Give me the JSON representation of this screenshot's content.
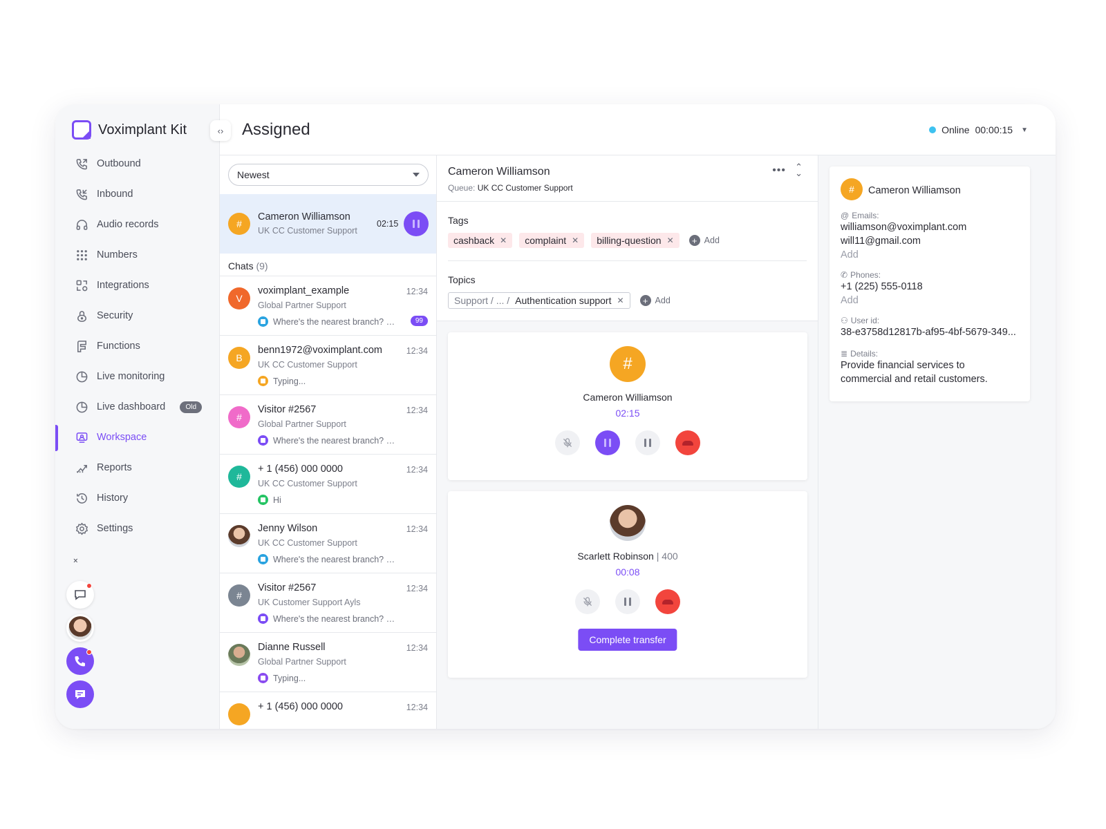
{
  "app": {
    "name": "Voximplant Kit"
  },
  "sidebar": {
    "items": [
      {
        "label": "Outbound",
        "icon": "outbound-call-icon"
      },
      {
        "label": "Inbound",
        "icon": "inbound-call-icon"
      },
      {
        "label": "Audio records",
        "icon": "headphones-icon"
      },
      {
        "label": "Numbers",
        "icon": "dialpad-icon"
      },
      {
        "label": "Integrations",
        "icon": "integrations-icon"
      },
      {
        "label": "Security",
        "icon": "lock-icon"
      },
      {
        "label": "Functions",
        "icon": "functions-icon"
      },
      {
        "label": "Live monitoring",
        "icon": "pie-chart-icon"
      },
      {
        "label": "Live dashboard",
        "icon": "pie-chart-icon",
        "badge": "Old"
      },
      {
        "label": "Workspace",
        "icon": "workspace-icon",
        "active": true
      },
      {
        "label": "Reports",
        "icon": "reports-icon"
      },
      {
        "label": "History",
        "icon": "history-icon"
      },
      {
        "label": "Settings",
        "icon": "gear-icon"
      }
    ]
  },
  "header": {
    "title": "Assigned",
    "status_label": "Online",
    "status_time": "00:00:15",
    "status_color": "#3ec2f0"
  },
  "list": {
    "filter_value": "Newest",
    "active_call": {
      "avatar": "#",
      "name": "Cameron Williamson",
      "queue": "UK CC Customer Support",
      "time": "02:15"
    },
    "chats_label": "Chats",
    "chats_count": "(9)",
    "chats": [
      {
        "avatar": "V",
        "color": "#f0682b",
        "name": "voximplant_example",
        "time": "12:34",
        "queue": "Global Partner Support",
        "channel": "telegram",
        "channel_color": "#2aa3e0",
        "message": "Where's the nearest branch? Where's the nearest branch?",
        "unread": "99"
      },
      {
        "avatar": "B",
        "color": "#f5a623",
        "name": "benn1972@voximplant.com",
        "time": "12:34",
        "queue": "UK CC Customer Support",
        "channel": "web",
        "channel_color": "#f5a623",
        "message": "Typing..."
      },
      {
        "avatar": "#",
        "color": "#f06bc9",
        "name": "Visitor #2567",
        "time": "12:34",
        "queue": "Global Partner Support",
        "channel": "chat",
        "channel_color": "#7b4df5",
        "message": "Where's the nearest branch? Where's the nearest branch?"
      },
      {
        "avatar": "#",
        "color": "#1fb89a",
        "name": "+ 1 (456) 000 0000",
        "time": "12:34",
        "queue": "UK CC Customer Support",
        "channel": "whatsapp",
        "channel_color": "#25c464",
        "message": "Hi"
      },
      {
        "avatar": "",
        "color": "photo",
        "name": "Jenny Wilson",
        "time": "12:34",
        "queue": "UK CC Customer Support",
        "channel": "telegram",
        "channel_color": "#2aa3e0",
        "message": "Where's the nearest branch? Where's the nearest branch?"
      },
      {
        "avatar": "#",
        "color": "#7b8592",
        "name": "Visitor #2567",
        "time": "12:34",
        "queue": "UK Customer Support Ayls",
        "channel": "chat",
        "channel_color": "#7b4df5",
        "message": "Where's the nearest branch? Where's the nearest branch?"
      },
      {
        "avatar": "",
        "color": "photo2",
        "name": "Dianne Russell",
        "time": "12:34",
        "queue": "Global Partner Support",
        "channel": "messenger",
        "channel_color": "#8a4cf0",
        "message": "Typing..."
      },
      {
        "avatar": "",
        "color": "#f5a623",
        "name": "+ 1 (456) 000 0000",
        "time": "12:34",
        "queue": "",
        "channel": "",
        "channel_color": "#f5a623",
        "message": ""
      }
    ]
  },
  "main": {
    "contact_name": "Cameron Williamson",
    "queue_label": "Queue:",
    "queue_value": "UK CC Customer Support",
    "tags_label": "Tags",
    "tags": [
      "cashback",
      "complaint",
      "billing-question"
    ],
    "add_label": "Add",
    "topics_label": "Topics",
    "topic_path": "Support / ... /",
    "topic_value": "Authentication support",
    "call1": {
      "avatar": "#",
      "name": "Cameron Williamson",
      "timer": "02:15"
    },
    "call2": {
      "name": "Scarlett Robinson",
      "ext": "| 400",
      "timer": "00:08",
      "button": "Complete transfer"
    }
  },
  "info": {
    "avatar": "#",
    "name": "Cameron Williamson",
    "emails_label": "Emails:",
    "emails": [
      "williamson@voximplant.com",
      "will11@gmail.com"
    ],
    "phones_label": "Phones:",
    "phones": [
      "+1 (225) 555-0118"
    ],
    "add_label": "Add",
    "userid_label": "User id:",
    "userid": "38-e3758d12817b-af95-4bf-5679-349...",
    "details_label": "Details:",
    "details": [
      "Provide financial services to",
      "commercial and retail customers."
    ]
  },
  "colors": {
    "accent": "#7b4df5",
    "orange": "#f5a623",
    "danger": "#f2453d"
  }
}
